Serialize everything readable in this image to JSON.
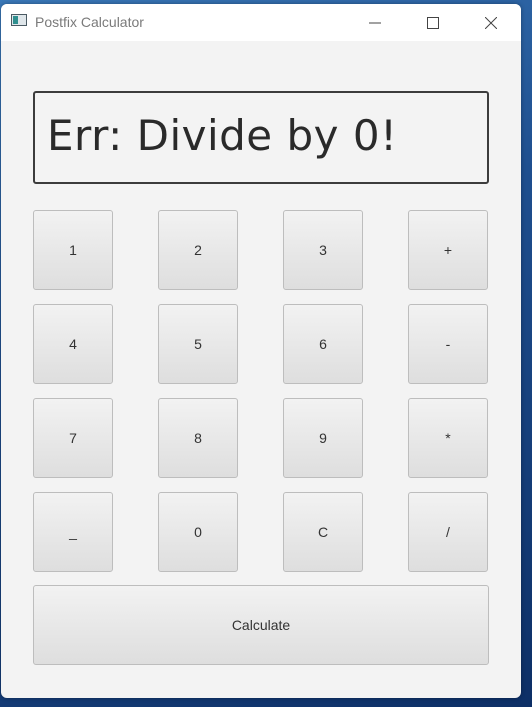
{
  "window": {
    "title": "Postfix Calculator"
  },
  "display": {
    "text": "Err: Divide by 0!"
  },
  "keys": {
    "k1": "1",
    "k2": "2",
    "k3": "3",
    "plus": "+",
    "k4": "4",
    "k5": "5",
    "k6": "6",
    "minus": "-",
    "k7": "7",
    "k8": "8",
    "k9": "9",
    "times": "*",
    "space": "_",
    "k0": "0",
    "clear": "C",
    "divide": "/"
  },
  "calculate_label": "Calculate"
}
